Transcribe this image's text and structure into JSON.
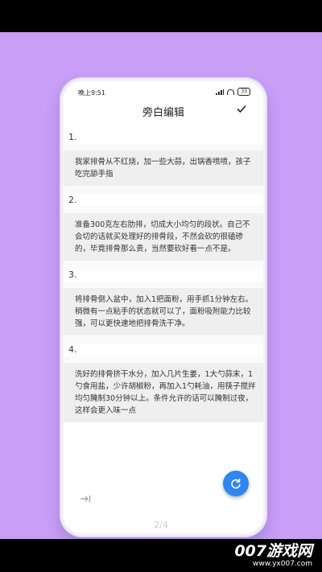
{
  "status_bar": {
    "time": "晚上9:51",
    "battery": "33"
  },
  "editor": {
    "title": "旁白编辑",
    "items": [
      {
        "number": "1.",
        "text": "我家排骨从不红烧，加一些大蒜，出锅香喷喷，孩子吃完舔手指"
      },
      {
        "number": "2.",
        "text": "准备300克左右肋排，切成大小均匀的段状。自己不会切的话就买处理好的排骨段，不然会砍的很磕碜的，毕竟排骨那么贵，当然要砍好看一点不是。"
      },
      {
        "number": "3.",
        "text": "将排骨倒入盆中，加入1把面粉，用手抓1分钟左右。稍微有一点粘手的状态就可以了，面粉吸附能力比较强，可以更快速地把排骨洗干净。"
      },
      {
        "number": "4.",
        "text": "洗好的排骨挤干水分，加入几片生姜，1大勺蒜末，1勺食用盐，少许胡椒粉，再加入1勺耗油，用筷子搅拌均匀腌制30分钟以上。条件允许的话可以腌制过夜，这样会更入味一点"
      }
    ]
  },
  "pager": "2/4",
  "watermark": {
    "name": "007游戏网",
    "url": "www.yx007.com"
  },
  "colors": {
    "background": "#c89ef7",
    "fab": "#2f86ef"
  }
}
